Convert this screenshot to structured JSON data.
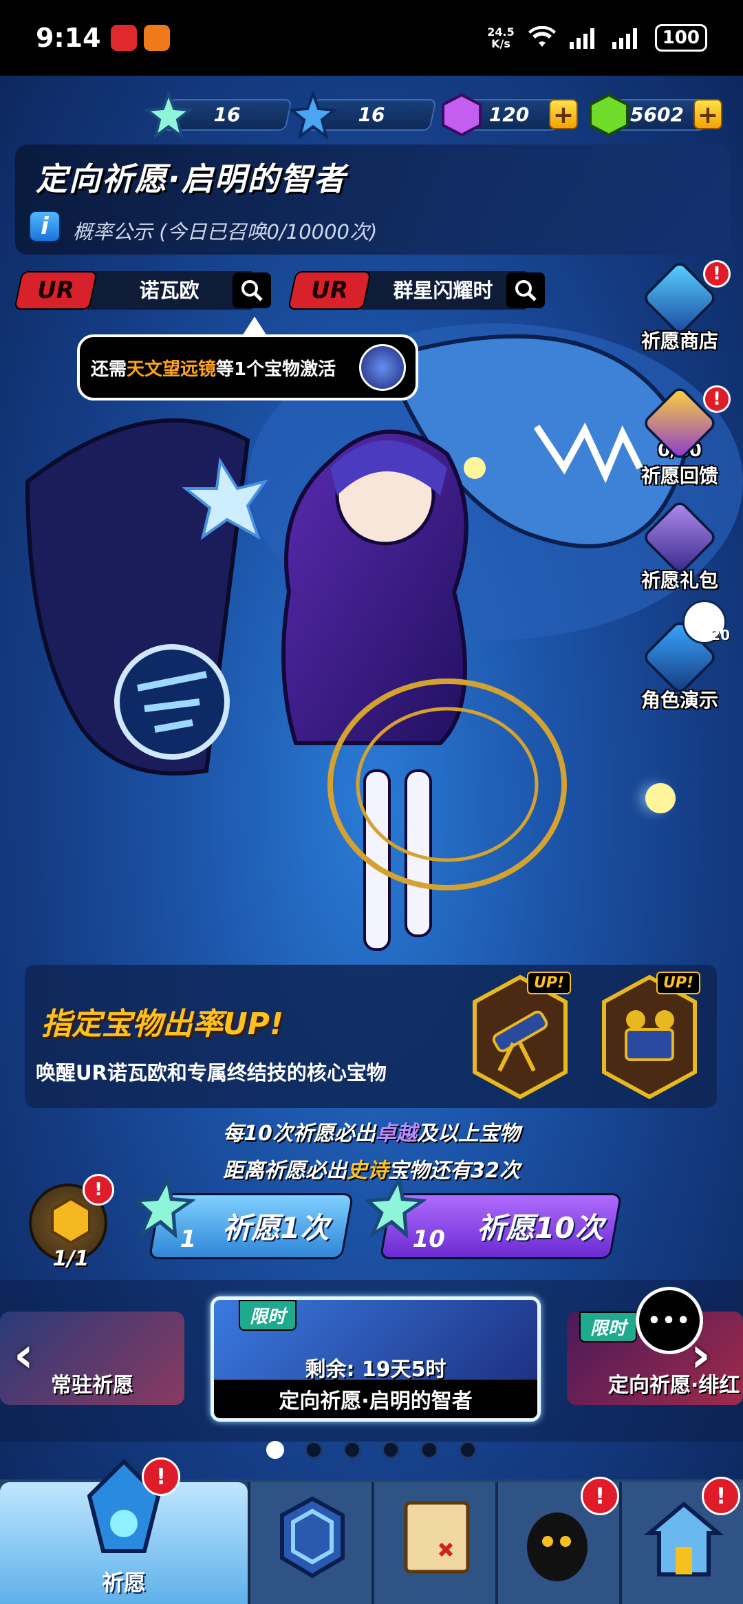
{
  "status_bar": {
    "time": "9:14",
    "net_speed_value": "24.5",
    "net_speed_unit": "K/s",
    "battery": "100"
  },
  "currencies": [
    {
      "icon": "rainbow-star-icon",
      "value": "16"
    },
    {
      "icon": "blue-star-icon",
      "value": "16"
    },
    {
      "icon": "purple-gem-icon",
      "value": "120",
      "plus": "+"
    },
    {
      "icon": "green-gem-icon",
      "value": "5602",
      "plus": "+"
    }
  ],
  "banner": {
    "title": "定向祈愿·启明的智者",
    "info_icon": "i",
    "probability_text": "概率公示 (今日已召唤0/10000次)"
  },
  "selectors": [
    {
      "rarity": "UR",
      "name": "诺瓦欧"
    },
    {
      "rarity": "UR",
      "name": "群星闪耀时"
    }
  ],
  "tooltip": {
    "prefix": "还需",
    "highlight": "天文望远镜",
    "suffix": "等1个宝物激活"
  },
  "side_menu": [
    {
      "label": "祈愿商店",
      "icon": "treasure-chest-icon",
      "badge": "!"
    },
    {
      "label": "祈愿回馈",
      "icon": "gold-coin-icon",
      "progress": "0/60",
      "badge": "!"
    },
    {
      "label": "祈愿礼包",
      "icon": "gift-bag-icon"
    },
    {
      "label": "角色演示",
      "icon": "video-clapper-icon",
      "bubble": "20"
    }
  ],
  "rate_up": {
    "title": "指定宝物出率UP!",
    "desc": "唤醒UR诺瓦欧和专属终结技的核心宝物",
    "treasures": [
      {
        "icon": "telescope-icon",
        "tag": "UP!"
      },
      {
        "icon": "astrolabe-icon",
        "tag": "UP!"
      }
    ]
  },
  "guarantee": {
    "line1_prefix": "每10次祈愿必出",
    "line1_highlight": "卓越",
    "line1_suffix": "及以上宝物",
    "line2_prefix": "距离祈愿必出",
    "line2_highlight": "史诗",
    "line2_suffix": "宝物还有32次"
  },
  "wish": {
    "token_count": "1/1",
    "token_badge": "!",
    "single": {
      "cost": "1",
      "label": "祈愿1次"
    },
    "multi": {
      "cost": "10",
      "label": "祈愿10次"
    }
  },
  "carousel": {
    "left_card": "常驻祈愿",
    "center_card": {
      "tag": "限时",
      "remaining": "剩余: 19天5时",
      "label": "定向祈愿·启明的智者"
    },
    "right_card": {
      "tag": "限时",
      "label": "定向祈愿·绯红"
    },
    "prev": "‹",
    "next": "›",
    "chat": "•••",
    "dots": [
      true,
      false,
      false,
      false,
      false,
      false
    ]
  },
  "nav": [
    {
      "label": "祈愿",
      "icon": "crystal-icon",
      "badge": "!",
      "active": true
    },
    {
      "label": "",
      "icon": "shield-emblem-icon"
    },
    {
      "label": "",
      "icon": "treasure-map-icon"
    },
    {
      "label": "",
      "icon": "shadow-creature-icon",
      "badge": "!"
    },
    {
      "label": "",
      "icon": "house-icon",
      "badge": "!"
    }
  ],
  "colors": {
    "accent_gold": "#ffc21a",
    "accent_purple": "#8a4be8",
    "accent_blue": "#4aa6f0",
    "ur_red": "#d8212b"
  }
}
